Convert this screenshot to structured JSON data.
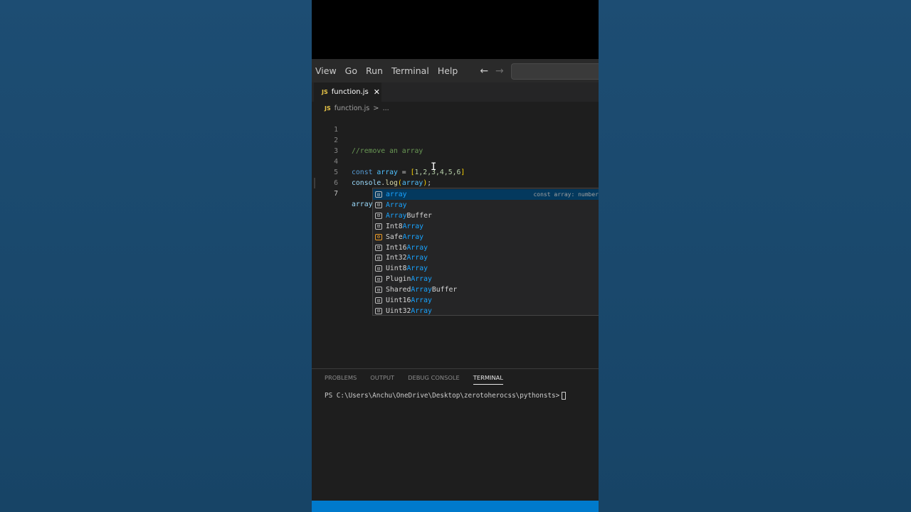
{
  "menubar": {
    "items": [
      "View",
      "Go",
      "Run",
      "Terminal",
      "Help"
    ],
    "back_arrow": "←",
    "forward_arrow": "→"
  },
  "tab": {
    "icon": "JS",
    "label": "function.js",
    "close": "✕"
  },
  "breadcrumb": {
    "icon": "JS",
    "file": "function.js",
    "sep": ">",
    "more": "..."
  },
  "editor": {
    "lines": [
      {
        "n": "1"
      },
      {
        "n": "2"
      },
      {
        "n": "3"
      },
      {
        "n": "4"
      },
      {
        "n": "5"
      },
      {
        "n": "6"
      },
      {
        "n": "7"
      }
    ],
    "line2": {
      "comment": "//remove an array"
    },
    "line4": {
      "kw": "const",
      "name": "array",
      "eq": " = ",
      "open": "[",
      "nums": "1,2,3,4,5,6",
      "close": "]"
    },
    "line5": {
      "obj": "console",
      "dot": ".",
      "fn": "log",
      "open": "(",
      "arg": "array",
      "close": ")",
      "semi": ";"
    },
    "line7": {
      "typed": "array"
    },
    "mouse_cursor": "I"
  },
  "suggestions": {
    "detail": "const array: number",
    "items": [
      {
        "icon": "⊡",
        "pre": "",
        "hl": "array",
        "post": "",
        "icon_color": "normal"
      },
      {
        "icon": "⊡",
        "pre": "",
        "hl": "Array",
        "post": "",
        "icon_color": "normal"
      },
      {
        "icon": "⊡",
        "pre": "",
        "hl": "Array",
        "post": "Buffer",
        "icon_color": "normal"
      },
      {
        "icon": "⊡",
        "pre": "Int8",
        "hl": "Array",
        "post": "",
        "icon_color": "normal"
      },
      {
        "icon": "⚙",
        "pre": "Safe",
        "hl": "Array",
        "post": "",
        "icon_color": "orange"
      },
      {
        "icon": "⊡",
        "pre": "Int16",
        "hl": "Array",
        "post": "",
        "icon_color": "normal"
      },
      {
        "icon": "⊡",
        "pre": "Int32",
        "hl": "Array",
        "post": "",
        "icon_color": "normal"
      },
      {
        "icon": "⊡",
        "pre": "Uint8",
        "hl": "Array",
        "post": "",
        "icon_color": "normal"
      },
      {
        "icon": "⊡",
        "pre": "Plugin",
        "hl": "Array",
        "post": "",
        "icon_color": "normal"
      },
      {
        "icon": "⊡",
        "pre": "Shared",
        "hl": "Array",
        "post": "Buffer",
        "icon_color": "normal"
      },
      {
        "icon": "⊡",
        "pre": "Uint16",
        "hl": "Array",
        "post": "",
        "icon_color": "normal"
      },
      {
        "icon": "⊡",
        "pre": "Uint32",
        "hl": "Array",
        "post": "",
        "icon_color": "normal"
      }
    ]
  },
  "panel": {
    "tabs": [
      "PROBLEMS",
      "OUTPUT",
      "DEBUG CONSOLE",
      "TERMINAL"
    ],
    "active_tab": "TERMINAL",
    "prompt": "PS C:\\Users\\Anchu\\OneDrive\\Desktop\\zerotoherocss\\pythonsts>"
  },
  "colors": {
    "accent": "#007acc",
    "background": "#1a4a6e",
    "editor_bg": "#1e1e1e"
  }
}
